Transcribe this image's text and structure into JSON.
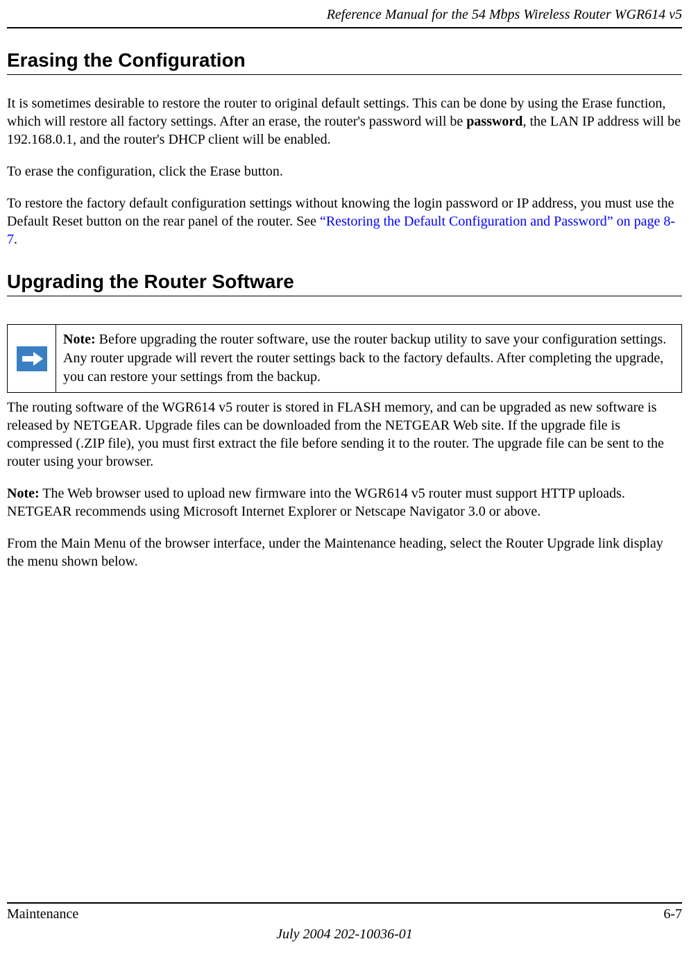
{
  "header": {
    "title": "Reference Manual for the 54 Mbps Wireless Router WGR614 v5"
  },
  "section1": {
    "heading": "Erasing the Configuration",
    "para1_prefix": "It is sometimes desirable to restore the router to original default settings. This can be done by using the Erase function, which will restore all factory settings. After an erase, the router's password will be ",
    "para1_bold": "password",
    "para1_suffix": ", the LAN IP address will be 192.168.0.1, and the router's DHCP client will be enabled.",
    "para2": "To erase the configuration, click the Erase button.",
    "para3_prefix": "To restore the factory default configuration settings without knowing the login password or IP address, you must use the Default Reset button on the rear panel of the router. See ",
    "para3_link": "“Restoring the Default Configuration and Password” on page 8-7",
    "para3_suffix": "."
  },
  "section2": {
    "heading": "Upgrading the Router Software",
    "note_bold": "Note:",
    "note_text": " Before upgrading the router software, use the router backup utility to save your configuration settings. Any router upgrade will revert the router settings back to the factory defaults. After completing the upgrade, you can restore your settings from the backup.",
    "para1": "The routing software of the WGR614 v5 router is stored in FLASH memory, and can be upgraded as new software is released by NETGEAR. Upgrade files can be downloaded from the NETGEAR Web site. If the upgrade file is compressed (.ZIP file), you must first extract the file before sending it to the router. The upgrade file can be sent to the router using your browser.",
    "para2_bold": "Note:",
    "para2_rest": " The Web browser used to upload new firmware into the WGR614 v5 router must support HTTP uploads. NETGEAR recommends using Microsoft Internet Explorer or Netscape Navigator 3.0 or above.",
    "para3": "From the Main Menu of the browser interface, under the Maintenance heading, select the Router Upgrade link display the menu shown below."
  },
  "footer": {
    "left": "Maintenance",
    "right": "6-7",
    "center": "July 2004 202-10036-01"
  }
}
